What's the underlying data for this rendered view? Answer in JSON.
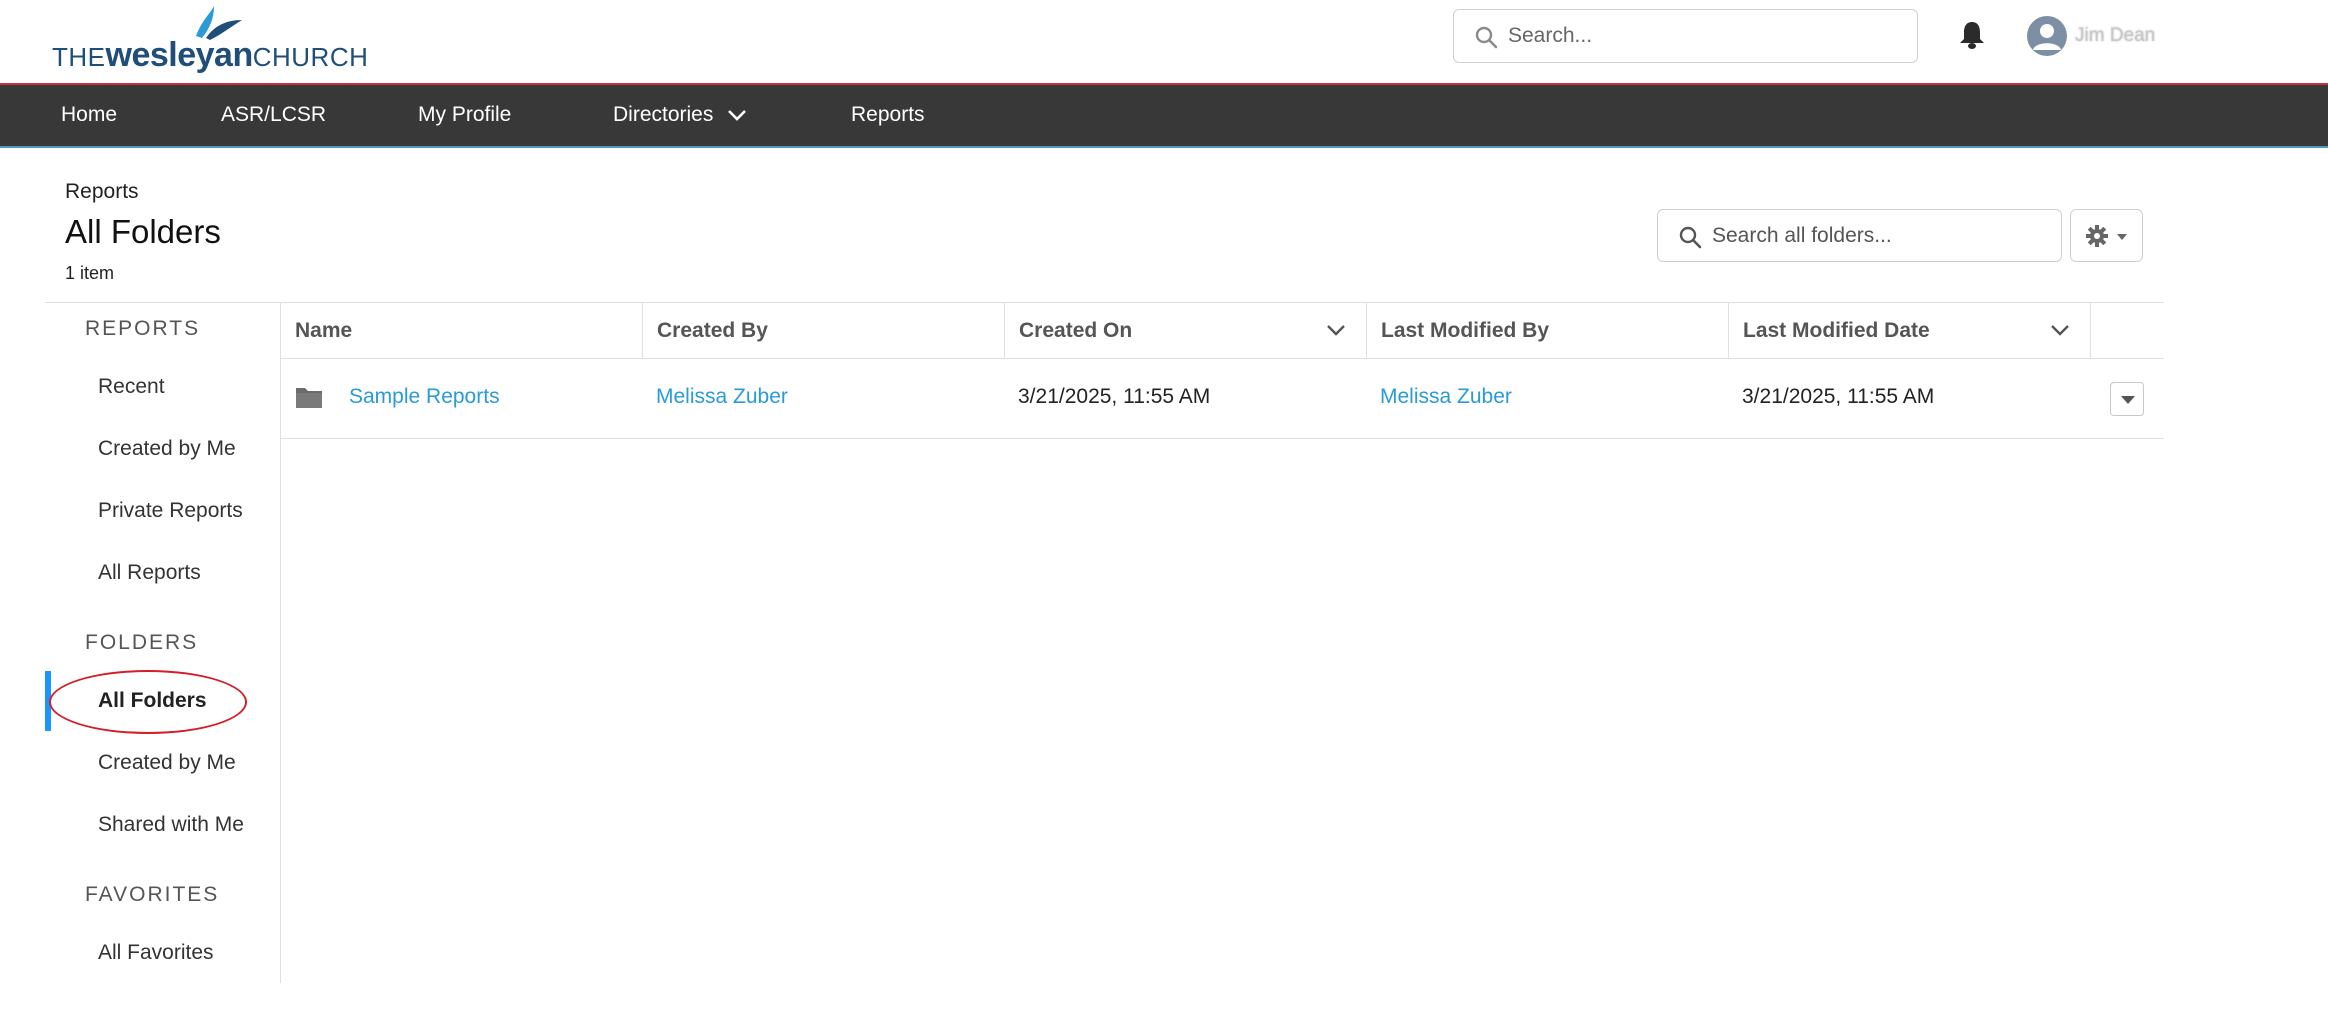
{
  "header": {
    "logo": {
      "the": "THE",
      "wesleyan": "wesleyan",
      "church": "CHURCH"
    },
    "search_placeholder": "Search...",
    "user_name": "Jim Dean"
  },
  "nav": {
    "items": [
      {
        "label": "Home"
      },
      {
        "label": "ASR/LCSR"
      },
      {
        "label": "My Profile"
      },
      {
        "label": "Directories"
      },
      {
        "label": "Reports"
      }
    ]
  },
  "page": {
    "breadcrumb": "Reports",
    "title": "All Folders",
    "count": "1 item",
    "search_placeholder": "Search all folders..."
  },
  "sidebar": {
    "sections": [
      {
        "heading": "REPORTS",
        "items": [
          "Recent",
          "Created by Me",
          "Private Reports",
          "All Reports"
        ]
      },
      {
        "heading": "FOLDERS",
        "items": [
          "All Folders",
          "Created by Me",
          "Shared with Me"
        ]
      },
      {
        "heading": "FAVORITES",
        "items": [
          "All Favorites"
        ]
      }
    ],
    "active": "All Folders"
  },
  "table": {
    "columns": [
      "Name",
      "Created By",
      "Created On",
      "Last Modified By",
      "Last Modified Date"
    ],
    "rows": [
      {
        "name": "Sample Reports",
        "created_by": "Melissa Zuber",
        "created_on": "3/21/2025, 11:55 AM",
        "last_modified_by": "Melissa Zuber",
        "last_modified_date": "3/21/2025, 11:55 AM"
      }
    ]
  },
  "colors": {
    "nav_bg": "#383838",
    "link": "#2a9bd8",
    "accent": "#1b96ff",
    "highlight": "#d21f2b",
    "logo": "#1e4e79"
  }
}
